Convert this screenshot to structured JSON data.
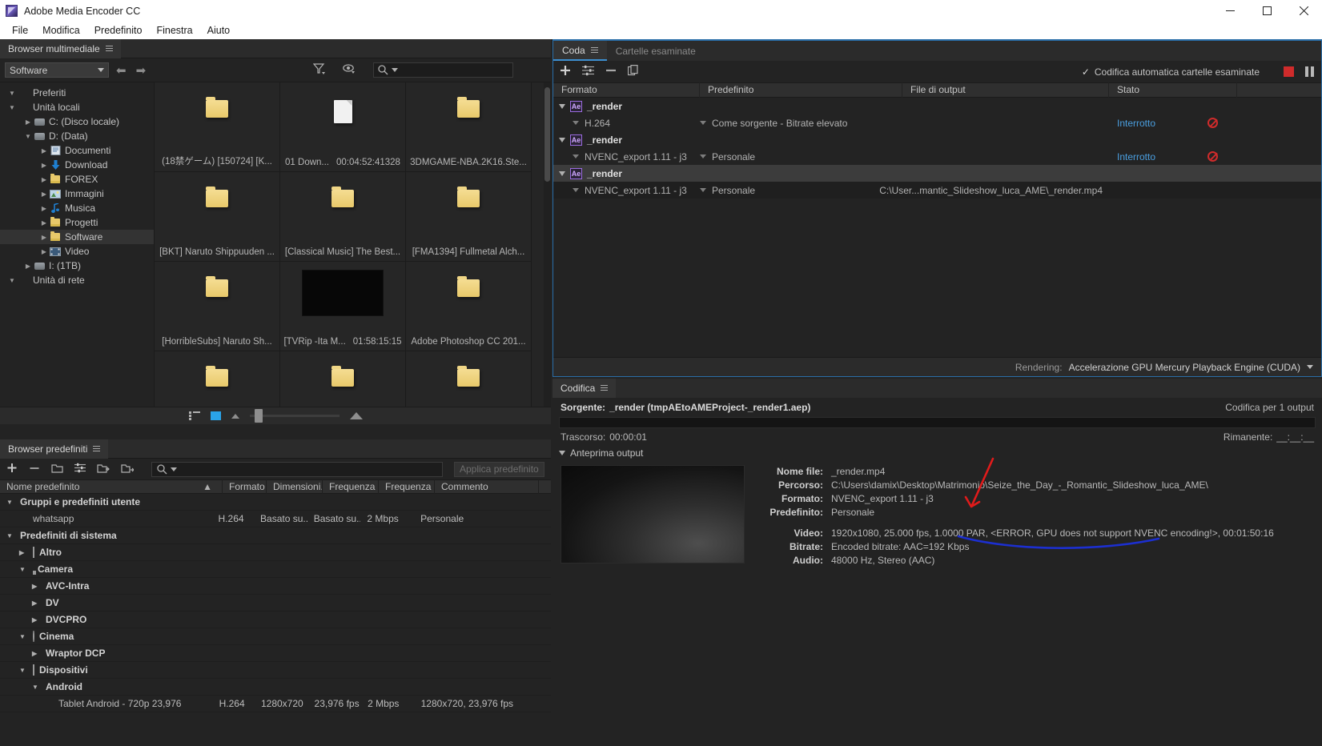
{
  "window": {
    "title": "Adobe Media Encoder CC",
    "minimize": "—",
    "maximize": "☐",
    "close": "✕"
  },
  "menubar": [
    "File",
    "Modifica",
    "Predefinito",
    "Finestra",
    "Aiuto"
  ],
  "media_browser": {
    "tab_label": "Browser multimediale",
    "source_dropdown": "Software",
    "search_placeholder": "",
    "tree": [
      {
        "label": "Preferiti",
        "indent": 0,
        "twisty": "down",
        "icon": "none",
        "selected": false
      },
      {
        "label": "Unità locali",
        "indent": 0,
        "twisty": "down",
        "icon": "none",
        "selected": false
      },
      {
        "label": "C: (Disco locale)",
        "indent": 1,
        "twisty": "right",
        "icon": "drive",
        "selected": false
      },
      {
        "label": "D: (Data)",
        "indent": 1,
        "twisty": "down",
        "icon": "drive",
        "selected": false
      },
      {
        "label": "Documenti",
        "indent": 2,
        "twisty": "right",
        "icon": "doc",
        "selected": false
      },
      {
        "label": "Download",
        "indent": 2,
        "twisty": "right",
        "icon": "download",
        "selected": false
      },
      {
        "label": "FOREX",
        "indent": 2,
        "twisty": "right",
        "icon": "folder",
        "selected": false
      },
      {
        "label": "Immagini",
        "indent": 2,
        "twisty": "right",
        "icon": "image",
        "selected": false
      },
      {
        "label": "Musica",
        "indent": 2,
        "twisty": "right",
        "icon": "music",
        "selected": false
      },
      {
        "label": "Progetti",
        "indent": 2,
        "twisty": "right",
        "icon": "folder",
        "selected": false
      },
      {
        "label": "Software",
        "indent": 2,
        "twisty": "right",
        "icon": "folder",
        "selected": true
      },
      {
        "label": "Video",
        "indent": 2,
        "twisty": "right",
        "icon": "video",
        "selected": false
      },
      {
        "label": "I: (1TB)",
        "indent": 1,
        "twisty": "right",
        "icon": "drive",
        "selected": false
      },
      {
        "label": "Unità di rete",
        "indent": 0,
        "twisty": "down",
        "icon": "none",
        "selected": false
      }
    ],
    "thumbnails": [
      {
        "name": "(18禁ゲーム) [150724] [K...",
        "duration": "",
        "kind": "folder"
      },
      {
        "name": "01 Down...",
        "duration": "00:04:52:41328",
        "kind": "doc"
      },
      {
        "name": "3DMGAME-NBA.2K16.Ste...",
        "duration": "",
        "kind": "folder"
      },
      {
        "name": "[BKT] Naruto Shippuuden ...",
        "duration": "",
        "kind": "folder"
      },
      {
        "name": "[Classical Music] The Best...",
        "duration": "",
        "kind": "folder"
      },
      {
        "name": "[FMA1394] Fullmetal Alch...",
        "duration": "",
        "kind": "folder"
      },
      {
        "name": "[HorribleSubs] Naruto Sh...",
        "duration": "",
        "kind": "folder"
      },
      {
        "name": "[TVRip -Ita M...",
        "duration": "01:58:15:15",
        "kind": "video"
      },
      {
        "name": "Adobe Photoshop CC 201...",
        "duration": "",
        "kind": "folder"
      },
      {
        "name": "",
        "duration": "",
        "kind": "folder"
      },
      {
        "name": "",
        "duration": "",
        "kind": "folder"
      },
      {
        "name": "",
        "duration": "",
        "kind": "folder"
      }
    ]
  },
  "preset_browser": {
    "tab_label": "Browser predefiniti",
    "apply_label": "Applica predefinito",
    "search_placeholder": "",
    "columns": [
      "Nome predefinito",
      "Formato",
      "Dimensioni...",
      "Frequenza ...",
      "Frequenza ...",
      "Commento"
    ],
    "rows": [
      {
        "type": "group",
        "indent": 0,
        "twisty": "down",
        "icon": "none",
        "name": "Gruppi e predefiniti utente",
        "format": "",
        "dim": "",
        "freq1": "",
        "freq2": "",
        "comment": ""
      },
      {
        "type": "item",
        "indent": 1,
        "twisty": "none",
        "icon": "none",
        "name": "whatsapp",
        "format": "H.264",
        "dim": "Basato su...",
        "freq1": "Basato su...",
        "freq2": "2 Mbps",
        "comment": "Personale"
      },
      {
        "type": "group",
        "indent": 0,
        "twisty": "down",
        "icon": "none",
        "name": "Predefiniti di sistema",
        "format": "",
        "dim": "",
        "freq1": "",
        "freq2": "",
        "comment": ""
      },
      {
        "type": "group",
        "indent": 1,
        "twisty": "right",
        "icon": "monitor",
        "name": "Altro",
        "format": "",
        "dim": "",
        "freq1": "",
        "freq2": "",
        "comment": ""
      },
      {
        "type": "group",
        "indent": 1,
        "twisty": "down",
        "icon": "cam",
        "name": "Camera",
        "format": "",
        "dim": "",
        "freq1": "",
        "freq2": "",
        "comment": ""
      },
      {
        "type": "group",
        "indent": 2,
        "twisty": "right",
        "icon": "none",
        "name": "AVC-Intra",
        "format": "",
        "dim": "",
        "freq1": "",
        "freq2": "",
        "comment": ""
      },
      {
        "type": "group",
        "indent": 2,
        "twisty": "right",
        "icon": "none",
        "name": "DV",
        "format": "",
        "dim": "",
        "freq1": "",
        "freq2": "",
        "comment": ""
      },
      {
        "type": "group",
        "indent": 2,
        "twisty": "right",
        "icon": "none",
        "name": "DVCPRO",
        "format": "",
        "dim": "",
        "freq1": "",
        "freq2": "",
        "comment": ""
      },
      {
        "type": "group",
        "indent": 1,
        "twisty": "down",
        "icon": "film",
        "name": "Cinema",
        "format": "",
        "dim": "",
        "freq1": "",
        "freq2": "",
        "comment": ""
      },
      {
        "type": "group",
        "indent": 2,
        "twisty": "right",
        "icon": "none",
        "name": "Wraptor DCP",
        "format": "",
        "dim": "",
        "freq1": "",
        "freq2": "",
        "comment": ""
      },
      {
        "type": "group",
        "indent": 1,
        "twisty": "down",
        "icon": "phone",
        "name": "Dispositivi",
        "format": "",
        "dim": "",
        "freq1": "",
        "freq2": "",
        "comment": ""
      },
      {
        "type": "group",
        "indent": 2,
        "twisty": "down",
        "icon": "none",
        "name": "Android",
        "format": "",
        "dim": "",
        "freq1": "",
        "freq2": "",
        "comment": ""
      },
      {
        "type": "item",
        "indent": 3,
        "twisty": "none",
        "icon": "none",
        "name": "Tablet Android - 720p 23,976",
        "format": "H.264",
        "dim": "1280x720",
        "freq1": "23,976 fps",
        "freq2": "2 Mbps",
        "comment": "1280x720, 23,976 fps"
      }
    ]
  },
  "queue": {
    "tabs": [
      {
        "label": "Coda",
        "active": true
      },
      {
        "label": "Cartelle esaminate",
        "active": false
      }
    ],
    "auto_encode_label": "Codifica automatica cartelle esaminate",
    "auto_encode_checked": true,
    "columns": [
      "Formato",
      "Predefinito",
      "File di output",
      "Stato"
    ],
    "rows": [
      {
        "type": "group",
        "name": "_render",
        "badge": "Ae",
        "selected": false,
        "children": [
          {
            "format": "H.264",
            "preset": "Come sorgente - Bitrate elevato",
            "output": "",
            "status": "Interrotto",
            "has_block_icon": true,
            "progress": false,
            "alt": false
          }
        ]
      },
      {
        "type": "group",
        "name": "_render",
        "badge": "Ae",
        "selected": false,
        "children": [
          {
            "format": "NVENC_export 1.11 - j3",
            "preset": "Personale",
            "output": "",
            "status": "Interrotto",
            "has_block_icon": true,
            "progress": false,
            "alt": false
          }
        ]
      },
      {
        "type": "group",
        "name": "_render",
        "badge": "Ae",
        "selected": true,
        "children": [
          {
            "format": "NVENC_export 1.11 - j3",
            "preset": "Personale",
            "output": "C:\\User...mantic_Slideshow_luca_AME\\_render.mp4",
            "status": "",
            "has_block_icon": false,
            "progress": true,
            "alt": true
          }
        ]
      }
    ],
    "rendering_label": "Rendering:",
    "rendering_value": "Accelerazione GPU Mercury Playback Engine (CUDA)"
  },
  "encoding": {
    "tab_label": "Codifica",
    "source_label": "Sorgente:",
    "source_value": "_render (tmpAEtoAMEProject-_render1.aep)",
    "outputs_label": "Codifica per 1 output",
    "elapsed_label": "Trascorso:",
    "elapsed_value": "00:00:01",
    "remaining_label": "Rimanente:",
    "remaining_value": "__:__:__",
    "preview_label": "Anteprima output",
    "details": [
      {
        "key": "Nome file:",
        "value": "_render.mp4"
      },
      {
        "key": "Percorso:",
        "value": "C:\\Users\\damix\\Desktop\\Matrimonio\\Seize_the_Day_-_Romantic_Slideshow_luca_AME\\"
      },
      {
        "key": "Formato:",
        "value": "NVENC_export 1.11 - j3"
      },
      {
        "key": "Predefinito:",
        "value": "Personale"
      }
    ],
    "details2": [
      {
        "key": "Video:",
        "value": "1920x1080, 25.000 fps, 1.0000 PAR, <ERROR, GPU does not support NVENC encoding!>, 00:01:50:16"
      },
      {
        "key": "Bitrate:",
        "value": "Encoded bitrate: AAC=192 Kbps"
      },
      {
        "key": "Audio:",
        "value": "48000 Hz, Stereo (AAC)"
      }
    ]
  },
  "annotations": {
    "arrow_color": "#e01b1b",
    "underline_color": "#1c2fd0"
  }
}
